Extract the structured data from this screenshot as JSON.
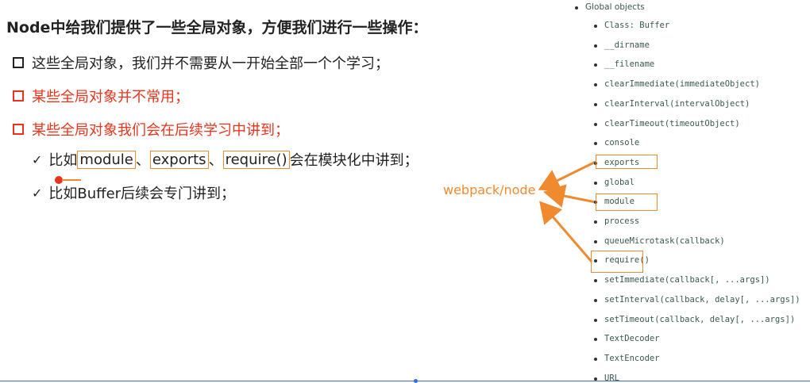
{
  "slide": {
    "title": "Node中给我们提供了一些全局对象，方便我们进行一些操作：",
    "bullet1": "这些全局对象，我们并不需要从一开始全部一个个学习；",
    "bullet2": "某些全局对象并不常用；",
    "bullet3": "某些全局对象我们会在后续学习中讲到；",
    "sub1": {
      "prefix": "比如",
      "module": "module",
      "sep1": "、",
      "exports": "exports",
      "sep2": "、",
      "require": "require()",
      "suffix": "会在模块化中讲到；"
    },
    "sub2": "比如Buffer后续会专门讲到；",
    "check": "✓"
  },
  "annotation": {
    "label": "webpack/node",
    "color": "#f08a2e"
  },
  "doc_list": {
    "heading": "Global objects",
    "items": [
      "Class: Buffer",
      "__dirname",
      "__filename",
      "clearImmediate(immediateObject)",
      "clearInterval(intervalObject)",
      "clearTimeout(timeoutObject)",
      "console",
      "exports",
      "global",
      "module",
      "process",
      "queueMicrotask(callback)",
      "require()",
      "setImmediate(callback[, ...args])",
      "setInterval(callback, delay[, ...args])",
      "setTimeout(callback, delay[, ...args])",
      "TextDecoder",
      "TextEncoder",
      "URL"
    ]
  },
  "colors": {
    "accent_red": "#e8341c",
    "highlight_orange": "#ee8a33",
    "text_dark": "#222222",
    "doc_text": "#3a5a4a",
    "progress_blue": "#2f6fd6"
  }
}
